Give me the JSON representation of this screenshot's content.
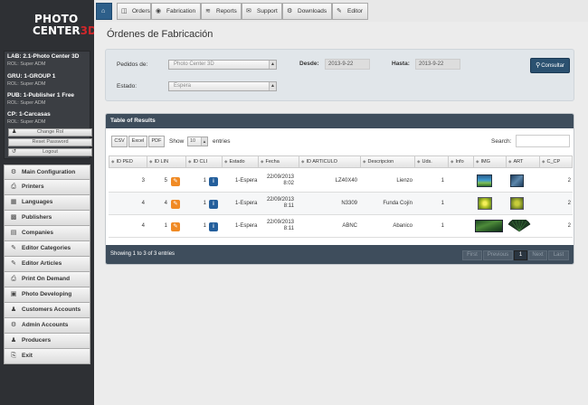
{
  "logo": {
    "line1": "Photo",
    "line2_white": "Center",
    "line2_red": "3D"
  },
  "user_box": [
    {
      "title": "LAB: 2.1-Photo Center 3D",
      "role": "ROL: Super ADM"
    },
    {
      "title": "GRU: 1-GROUP 1",
      "role": "ROL: Super ADM"
    },
    {
      "title": "PUB: 1-Publisher 1 Free",
      "role": "ROL: Super ADM"
    },
    {
      "title": "CP: 1-Carcasas",
      "role": "ROL: Super ADM"
    }
  ],
  "user_buttons": {
    "change_rol": "Change Rol",
    "reset_password": "Reset Password",
    "logout": "Logout"
  },
  "menu": [
    {
      "label": "Main Configuration",
      "icon": "gear-icon"
    },
    {
      "label": "Printers",
      "icon": "printer-icon"
    },
    {
      "label": "Languages",
      "icon": "language-icon"
    },
    {
      "label": "Publishers",
      "icon": "publisher-icon"
    },
    {
      "label": "Companies",
      "icon": "company-icon"
    },
    {
      "label": "Editor Categories",
      "icon": "pencil-icon"
    },
    {
      "label": "Editor Articles",
      "icon": "pencil-icon"
    },
    {
      "label": "Print On Demand",
      "icon": "print-icon"
    },
    {
      "label": "Photo Developing",
      "icon": "image-icon"
    },
    {
      "label": "Customers Accounts",
      "icon": "users-icon"
    },
    {
      "label": "Admin Accounts",
      "icon": "gear-icon"
    },
    {
      "label": "Producers",
      "icon": "users-icon"
    },
    {
      "label": "Exit",
      "icon": "exit-icon"
    }
  ],
  "topnav": {
    "tabs": [
      {
        "label": "Orders",
        "icon": "orders-icon"
      },
      {
        "label": "Fabrication",
        "icon": "car-icon"
      },
      {
        "label": "Reports",
        "icon": "chart-icon"
      },
      {
        "label": "Support",
        "icon": "envelope-icon"
      },
      {
        "label": "Downloads",
        "icon": "gears-icon"
      },
      {
        "label": "Editor",
        "icon": "pencil-icon"
      }
    ]
  },
  "page_title": "Órdenes de Fabricación",
  "filters": {
    "pedidos_label": "Pedidos de:",
    "pedidos_value": "Photo Center 3D",
    "estado_label": "Estado:",
    "estado_value": "Espera",
    "desde_label": "Desde:",
    "desde_value": "2013-9-22",
    "hasta_label": "Hasta:",
    "hasta_value": "2013-9-22",
    "consult_label": "Consultar"
  },
  "results": {
    "title": "Table of Results",
    "buttons": [
      "CSV",
      "Excel",
      "PDF"
    ],
    "show_label": "Show",
    "show_value": "10",
    "entries_label": "entries",
    "search_label": "Search:",
    "columns": [
      "ID PED",
      "ID LIN",
      "ID CLI",
      "Estado",
      "Fecha",
      "ID ARTICULO",
      "Descripcion",
      "Uds.",
      "Info",
      "IMG",
      "ART",
      "C_CP"
    ],
    "rows": [
      {
        "id_ped": "3",
        "id_lin": "5",
        "id_cli": "1",
        "estado": "1-Espera",
        "fecha_date": "22/09/2013",
        "fecha_time": "8:02",
        "articulo": "LZ40X40",
        "descripcion": "Lienzo",
        "uds": "1",
        "info": "",
        "c_cp": "2"
      },
      {
        "id_ped": "4",
        "id_lin": "4",
        "id_cli": "1",
        "estado": "1-Espera",
        "fecha_date": "22/09/2013",
        "fecha_time": "8:11",
        "articulo": "N3309",
        "descripcion": "Funda Cojín",
        "uds": "1",
        "info": "",
        "c_cp": "2"
      },
      {
        "id_ped": "4",
        "id_lin": "1",
        "id_cli": "1",
        "estado": "1-Espera",
        "fecha_date": "22/09/2013",
        "fecha_time": "8:11",
        "articulo": "ABNC",
        "descripcion": "Abanico",
        "uds": "1",
        "info": "",
        "c_cp": "2"
      }
    ],
    "footer": "Showing 1 to 3 of 3 entries",
    "pagination": [
      "First",
      "Previous",
      "1",
      "Next",
      "Last"
    ]
  },
  "colors": {
    "sidebar": "#2e3034",
    "header": "#3e4d5c",
    "accent": "#2b5170",
    "edit": "#f08a24",
    "info": "#245f9c",
    "logo_red": "#d0272b"
  }
}
